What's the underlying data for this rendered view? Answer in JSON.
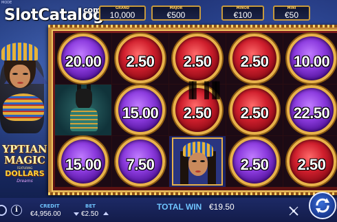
{
  "top": {
    "mode_label": "MODE",
    "watermark_brand": "SlotCatalog",
    "watermark_suffix": "com",
    "jackpots": [
      {
        "label": "GRAND",
        "value": "10,000"
      },
      {
        "label": "MAJOR",
        "value": "€500"
      },
      {
        "label": "MINOR",
        "value": "€100"
      },
      {
        "label": "MINI",
        "value": "€50"
      }
    ]
  },
  "game_logo": {
    "line1": "YPTIAN",
    "line2": "MAGIC",
    "featuring": "FEATURING",
    "line3": "DOLLARS",
    "line4": "Dreams"
  },
  "reels": [
    [
      {
        "kind": "coin",
        "color": "purple",
        "value": "20.00"
      },
      {
        "kind": "anubis"
      },
      {
        "kind": "coin",
        "color": "purple",
        "value": "15.00"
      }
    ],
    [
      {
        "kind": "coin",
        "color": "red",
        "value": "2.50"
      },
      {
        "kind": "coin",
        "color": "purple",
        "value": "15.00"
      },
      {
        "kind": "coin",
        "color": "purple",
        "value": "7.50"
      }
    ],
    [
      {
        "kind": "coin",
        "color": "red",
        "value": "2.50"
      },
      {
        "kind": "coin",
        "color": "red",
        "value": "2.50"
      },
      {
        "kind": "cleopatra"
      }
    ],
    [
      {
        "kind": "coin",
        "color": "red",
        "value": "2.50"
      },
      {
        "kind": "coin",
        "color": "red",
        "value": "2.50"
      },
      {
        "kind": "coin",
        "color": "purple",
        "value": "2.50"
      }
    ],
    [
      {
        "kind": "coin",
        "color": "purple",
        "value": "10.00"
      },
      {
        "kind": "coin",
        "color": "purple",
        "value": "22.50"
      },
      {
        "kind": "coin",
        "color": "red",
        "value": "2.50"
      }
    ]
  ],
  "bottom": {
    "credit_label": "CREDIT",
    "credit_value": "€4,956.00",
    "bet_label": "BET",
    "bet_value": "€2.50",
    "total_win_label": "TOTAL WIN",
    "total_win_value": "€19.50",
    "info_glyph": "i"
  },
  "icons": {
    "menu": "menu-icon",
    "info": "info-icon",
    "bet_down": "chevron-down-icon",
    "bet_up": "chevron-up-icon",
    "turbo": "turbo-icon",
    "spin": "spin-arrows-icon"
  },
  "colors": {
    "coin_purple": "#8c3bde",
    "coin_red": "#d01f2d",
    "gold": "#e8b24a",
    "label_blue": "#6fc4ff"
  }
}
